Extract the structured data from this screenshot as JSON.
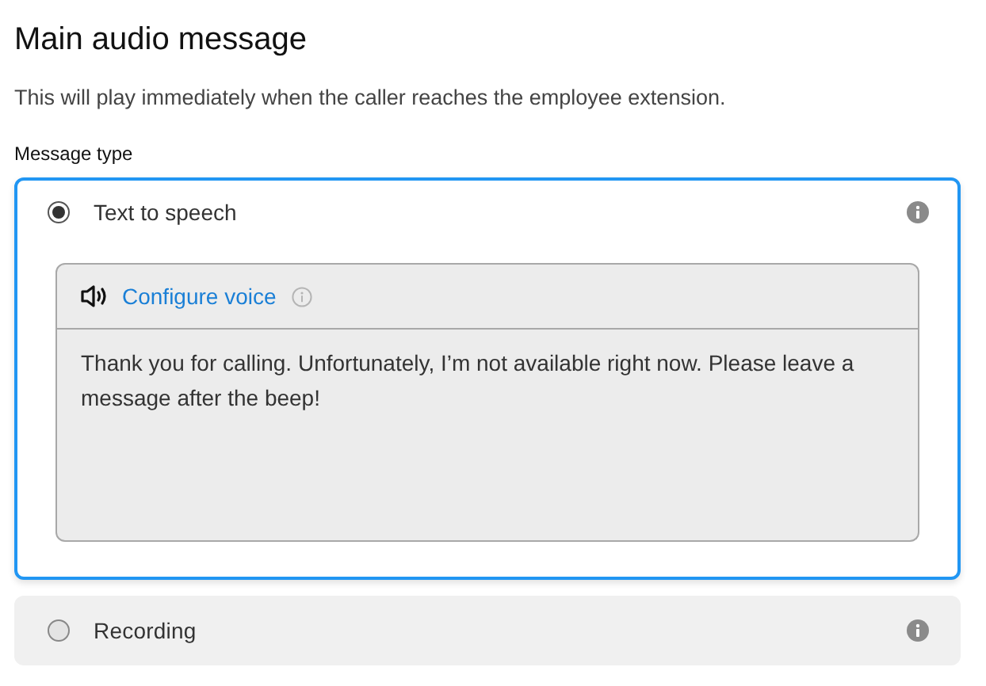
{
  "title": "Main audio message",
  "description": "This will play immediately when the caller reaches the employee extension.",
  "field_label": "Message type",
  "options": [
    {
      "kind": "tts",
      "label": "Text to speech",
      "selected": true,
      "voice_link": "Configure voice",
      "message": "Thank you for calling. Unfortunately, I’m not available right now. Please leave a message after the beep!"
    },
    {
      "kind": "recording",
      "label": "Recording",
      "selected": false
    }
  ]
}
